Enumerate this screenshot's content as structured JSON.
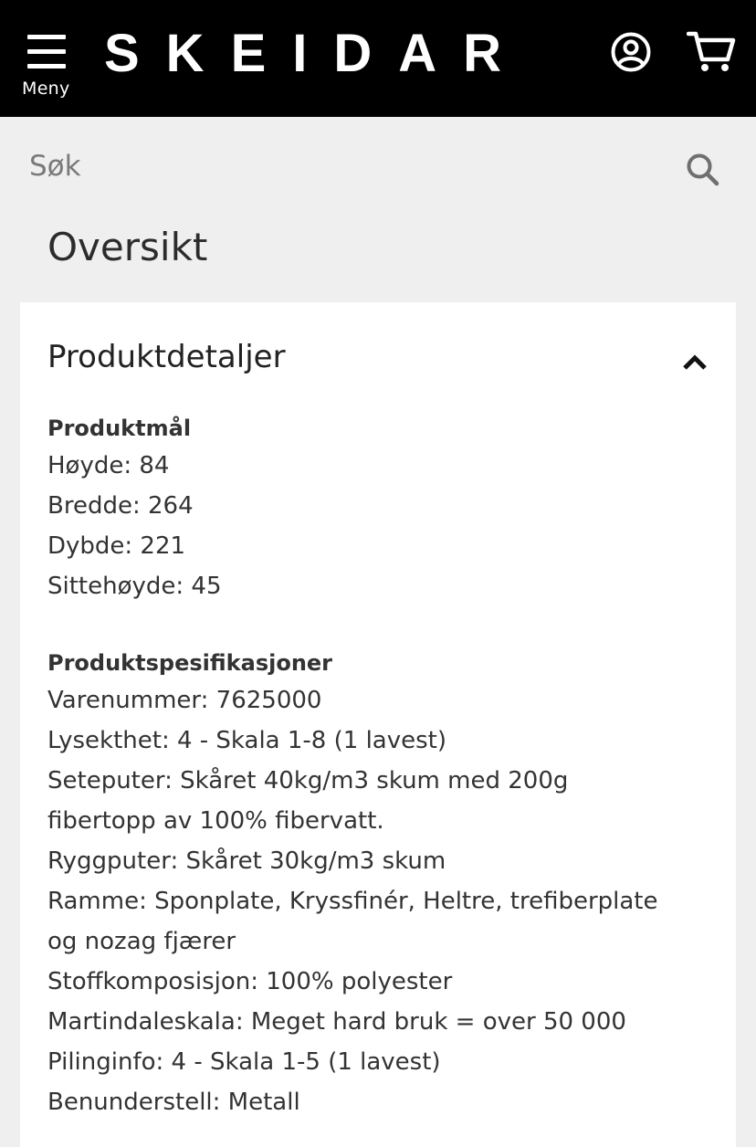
{
  "header": {
    "menu_label": "Meny",
    "brand": "SKEIDAR",
    "icons": {
      "menu": "hamburger-icon",
      "account": "user-circle-icon",
      "cart": "shopping-cart-icon"
    }
  },
  "search": {
    "placeholder": "Søk",
    "icon": "search-icon"
  },
  "page": {
    "title": "Oversikt"
  },
  "panel": {
    "title": "Produktdetaljer",
    "expanded": true,
    "dimensions": {
      "heading": "Produktmål",
      "lines": [
        "Høyde: 84",
        "Bredde: 264",
        "Dybde: 221",
        "Sittehøyde: 45"
      ]
    },
    "specs": {
      "heading": "Produktspesifikasjoner",
      "lines": [
        "Varenummer: 7625000",
        "Lysekthet: 4 - Skala 1-8 (1 lavest)",
        "Seteputer: Skåret 40kg/m3 skum med 200g",
        "fibertopp av 100% fibervatt.",
        "Ryggputer: Skåret 30kg/m3 skum",
        "Ramme: Sponplate, Kryssfinér, Heltre, trefiberplate",
        "og nozag fjærer",
        "Stoffkomposisjon: 100% polyester",
        "Martindaleskala: Meget hard bruk = over 50 000",
        "Pilinginfo: 4 - Skala 1-5 (1 lavest)",
        "Benunderstell: Metall"
      ]
    }
  },
  "colors": {
    "header_bg": "#000000",
    "page_bg": "#efefef",
    "panel_bg": "#ffffff",
    "text": "#333333"
  }
}
